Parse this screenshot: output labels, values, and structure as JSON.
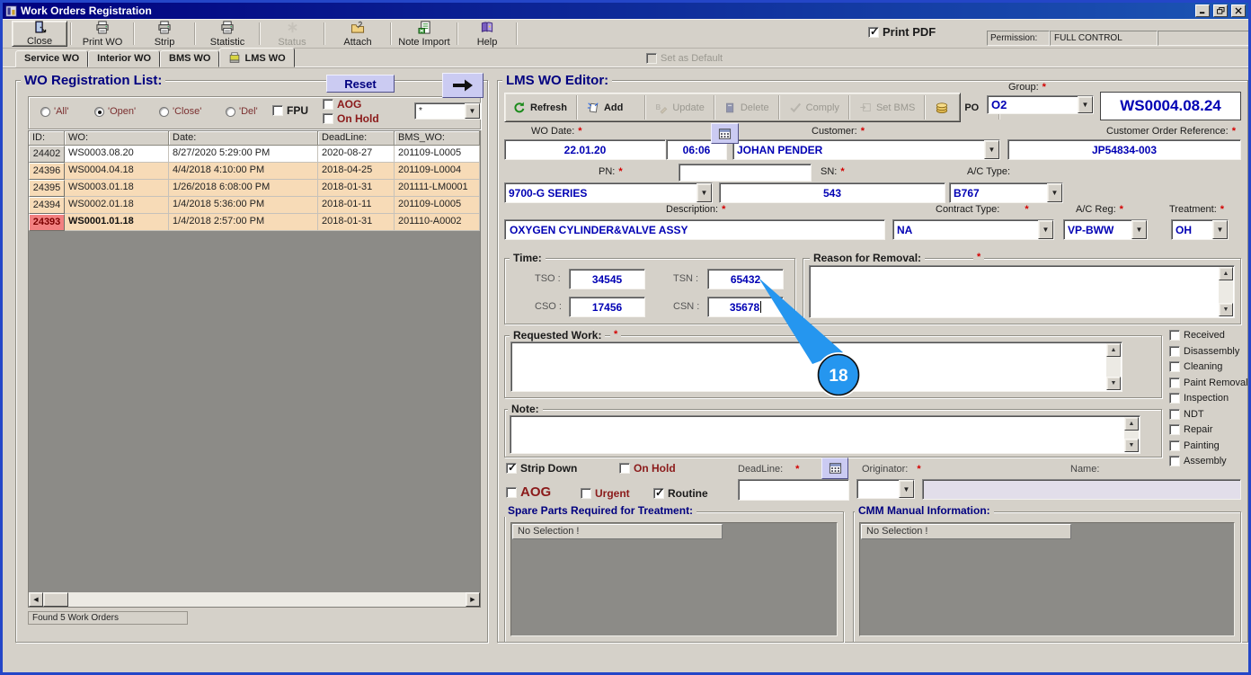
{
  "window": {
    "title": "Work Orders Registration"
  },
  "toolbar": {
    "buttons": [
      {
        "label": "Close",
        "icon": "exit-door-icon",
        "enabled": true
      },
      {
        "label": "Print WO",
        "icon": "printer-icon",
        "enabled": true
      },
      {
        "label": "Strip",
        "icon": "printer-icon",
        "enabled": true
      },
      {
        "label": "Statistic",
        "icon": "printer-icon",
        "enabled": true
      },
      {
        "label": "Status",
        "icon": "asterisk-icon",
        "enabled": false
      },
      {
        "label": "Attach",
        "icon": "folder-clip-icon",
        "enabled": true
      },
      {
        "label": "Note Import",
        "icon": "spreadsheet-icon",
        "enabled": true
      },
      {
        "label": "Help",
        "icon": "help-book-icon",
        "enabled": true
      }
    ],
    "print_pdf": {
      "label": "Print PDF",
      "checked": true
    },
    "permission": {
      "label": "Permission:",
      "value": "FULL CONTROL",
      "extra": ""
    }
  },
  "tabs": {
    "items": [
      {
        "label": "Service WO",
        "active": false
      },
      {
        "label": "Interior WO",
        "active": false
      },
      {
        "label": "BMS WO",
        "active": false
      },
      {
        "label": "LMS WO",
        "active": true
      }
    ],
    "set_as_default": {
      "label": "Set as Default",
      "checked": false,
      "enabled": false
    }
  },
  "wo_list": {
    "title": "WO Registration List:",
    "reset_label": "Reset",
    "filters": {
      "radios": [
        {
          "label": "'All'",
          "selected": false
        },
        {
          "label": "'Open'",
          "selected": true
        },
        {
          "label": "'Close'",
          "selected": false
        },
        {
          "label": "'Del'",
          "selected": false
        }
      ],
      "fpu": {
        "label": "FPU",
        "checked": false
      },
      "aog": {
        "label": "AOG",
        "checked": false
      },
      "on_hold": {
        "label": "On Hold",
        "checked": false
      },
      "search_value": "*"
    },
    "table": {
      "columns": [
        "ID:",
        "WO:",
        "Date:",
        "DeadLine:",
        "BMS_WO:"
      ],
      "rows": [
        {
          "id": "24402",
          "wo": "WS0003.08.20",
          "date": "8/27/2020 5:29:00 PM",
          "deadline": "2020-08-27",
          "bms": "201109-L0005",
          "selected": false
        },
        {
          "id": "24396",
          "wo": "WS0004.04.18",
          "date": "4/4/2018 4:10:00 PM",
          "deadline": "2018-04-25",
          "bms": "201109-L0004",
          "selected": false
        },
        {
          "id": "24395",
          "wo": "WS0003.01.18",
          "date": "1/26/2018 6:08:00 PM",
          "deadline": "2018-01-31",
          "bms": "201111-LM0001",
          "selected": false
        },
        {
          "id": "24394",
          "wo": "WS0002.01.18",
          "date": "1/4/2018 5:36:00 PM",
          "deadline": "2018-01-11",
          "bms": "201109-L0005",
          "selected": false
        },
        {
          "id": "24393",
          "wo": "WS0001.01.18",
          "date": "1/4/2018 2:57:00 PM",
          "deadline": "2018-01-31",
          "bms": "201110-A0002",
          "selected": true
        }
      ]
    },
    "status": "Found 5 Work Orders"
  },
  "editor": {
    "title": "LMS WO Editor:",
    "toolbar": [
      {
        "label": "Refresh",
        "icon": "refresh-icon",
        "enabled": true
      },
      {
        "label": "Add",
        "icon": "new-sparkle-icon",
        "enabled": true
      },
      {
        "label": "Update",
        "icon": "update-icon",
        "enabled": false
      },
      {
        "label": "Delete",
        "icon": "delete-icon",
        "enabled": false
      },
      {
        "label": "Comply",
        "icon": "check-icon",
        "enabled": false
      },
      {
        "label": "Set BMS",
        "icon": "window-arrow-icon",
        "enabled": false
      },
      {
        "label": "PO",
        "icon": "coins-icon",
        "enabled": true
      }
    ],
    "group": {
      "label": "Group:",
      "value": "O2"
    },
    "wo_number": "WS0004.08.24",
    "wo_date": {
      "label": "WO Date:",
      "date": "22.01.20",
      "time": "06:06"
    },
    "customer": {
      "label": "Customer:",
      "value": "JOHAN PENDER"
    },
    "customer_order_ref": {
      "label": "Customer Order Reference:",
      "value": "JP54834-003"
    },
    "pn": {
      "label": "PN:",
      "value": "9700-G SERIES",
      "extra_value": ""
    },
    "sn": {
      "label": "SN:",
      "value": "543"
    },
    "ac_type": {
      "label": "A/C Type:",
      "value": "B767"
    },
    "description": {
      "label": "Description:",
      "value": "OXYGEN CYLINDER&VALVE ASSY"
    },
    "contract_type": {
      "label": "Contract Type:",
      "value": "NA"
    },
    "ac_reg": {
      "label": "A/C Reg:",
      "value": "VP-BWW"
    },
    "treatment": {
      "label": "Treatment:",
      "value": "OH"
    },
    "time": {
      "title": "Time:",
      "tso_label": "TSO :",
      "tso": "34545",
      "tsn_label": "TSN :",
      "tsn": "65432",
      "cso_label": "CSO :",
      "cso": "17456",
      "csn_label": "CSN :",
      "csn": "35678"
    },
    "reason": {
      "title": "Reason for Removal:",
      "value": ""
    },
    "requested_work": {
      "title": "Requested Work:",
      "value": ""
    },
    "note": {
      "title": "Note:",
      "value": ""
    },
    "stage_checkboxes": [
      {
        "label": "Received",
        "checked": false
      },
      {
        "label": "Disassembly",
        "checked": false
      },
      {
        "label": "Cleaning",
        "checked": false
      },
      {
        "label": "Paint Removal",
        "checked": false
      },
      {
        "label": "Inspection",
        "checked": false
      },
      {
        "label": "NDT",
        "checked": false
      },
      {
        "label": "Repair",
        "checked": false
      },
      {
        "label": "Painting",
        "checked": false
      },
      {
        "label": "Assembly",
        "checked": false
      }
    ],
    "strip_down": {
      "label": "Strip Down",
      "checked": true
    },
    "on_hold": {
      "label": "On Hold",
      "checked": false
    },
    "aog": {
      "label": "AOG",
      "checked": false
    },
    "urgent": {
      "label": "Urgent",
      "checked": false
    },
    "routine": {
      "label": "Routine",
      "checked": true
    },
    "deadline": {
      "label": "DeadLine:",
      "value": ""
    },
    "originator": {
      "label": "Originator:",
      "value": ""
    },
    "name": {
      "label": "Name:",
      "value": ""
    },
    "spare_parts": {
      "title": "Spare Parts Required for Treatment:",
      "empty_text": "No Selection !"
    },
    "cmm": {
      "title": "CMM Manual Information:",
      "empty_text": "No Selection !"
    }
  },
  "callout": {
    "number": "18",
    "color": "#2596EF"
  },
  "colors": {
    "titlebar_navy": "#00007E",
    "window_bg": "#D5D1C9",
    "value_blue": "#0000B4",
    "header_navy": "#000080",
    "red_label": "#8B1A1A",
    "row_peach": "#F7DBB7",
    "row_selected_red": "#F28080",
    "lavender_button": "#CBCBF2",
    "list_gray": "#8C8B87"
  }
}
